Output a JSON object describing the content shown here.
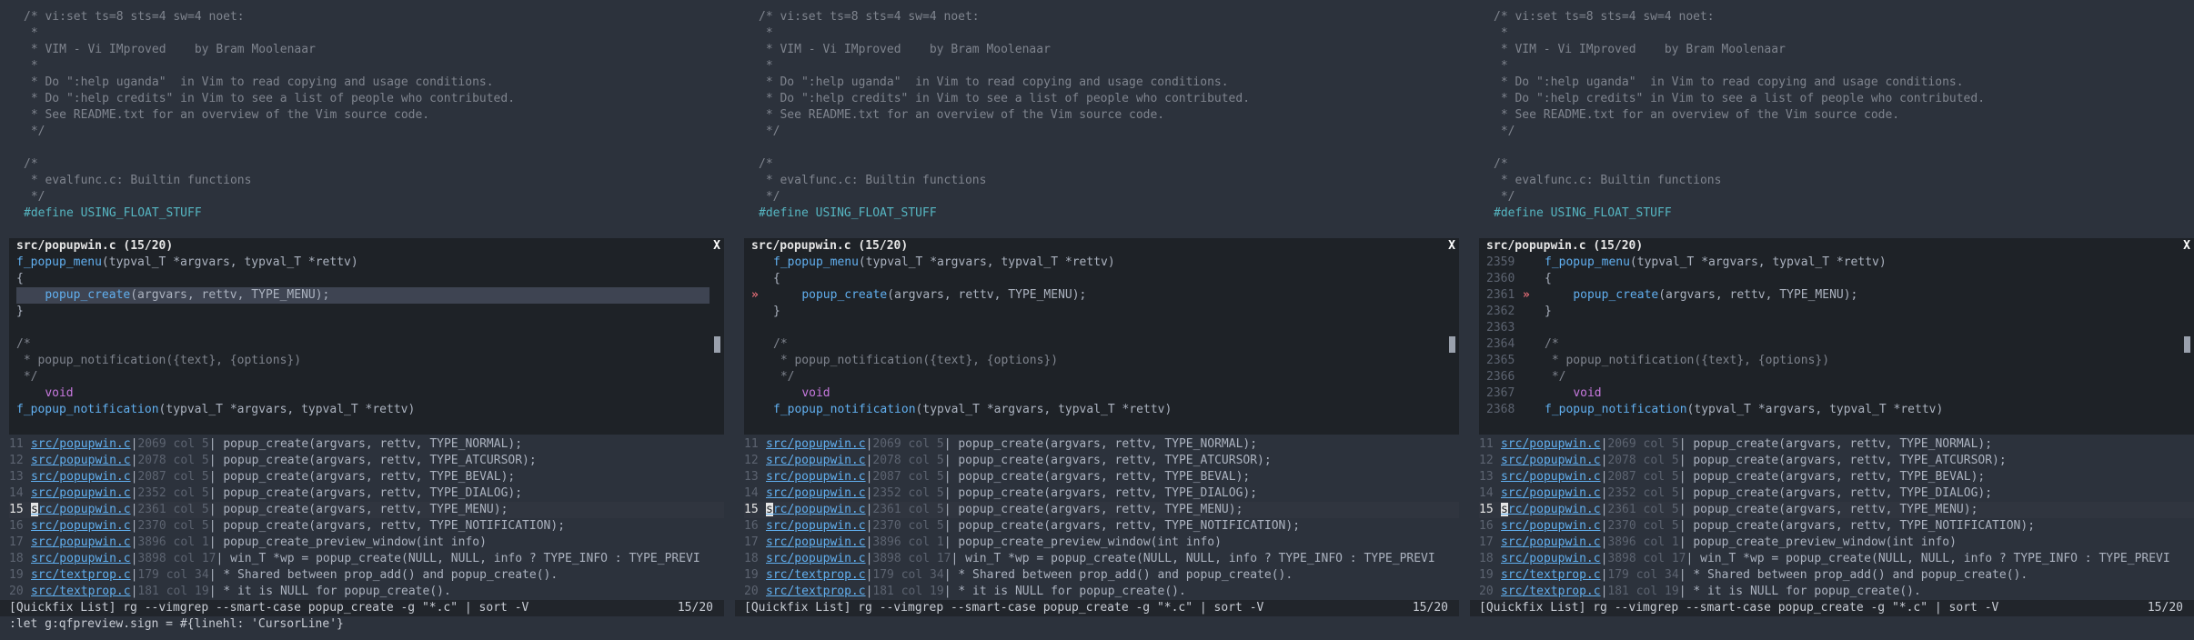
{
  "source_lines": [
    {
      "cls": "comment",
      "text": "/* vi:set ts=8 sts=4 sw=4 noet:"
    },
    {
      "cls": "comment",
      "text": " *"
    },
    {
      "cls": "comment",
      "text": " * VIM - Vi IMproved    by Bram Moolenaar"
    },
    {
      "cls": "comment",
      "text": " *"
    },
    {
      "cls": "comment",
      "text": " * Do \":help uganda\"  in Vim to read copying and usage conditions."
    },
    {
      "cls": "comment",
      "text": " * Do \":help credits\" in Vim to see a list of people who contributed."
    },
    {
      "cls": "comment",
      "text": " * See README.txt for an overview of the Vim source code."
    },
    {
      "cls": "comment",
      "text": " */"
    },
    {
      "cls": "",
      "text": ""
    },
    {
      "cls": "comment",
      "text": "/*"
    },
    {
      "cls": "comment",
      "text": " * evalfunc.c: Builtin functions"
    },
    {
      "cls": "comment",
      "text": " */"
    },
    {
      "cls": "pre",
      "text": "#define USING_FLOAT_STUFF"
    }
  ],
  "popup": {
    "title": "src/popupwin.c (15/20)",
    "close": "X",
    "sign_text": "»",
    "lines": [
      {
        "num": "2359",
        "parts": [
          {
            "c": "fn",
            "t": "f_popup_menu"
          },
          {
            "c": "",
            "t": "(typval_T *argvars, typval_T *rettv)"
          }
        ]
      },
      {
        "num": "2360",
        "parts": [
          {
            "c": "",
            "t": "{"
          }
        ]
      },
      {
        "num": "2361",
        "parts": [
          {
            "c": "",
            "t": "    "
          },
          {
            "c": "fn",
            "t": "popup_create"
          },
          {
            "c": "",
            "t": "(argvars, rettv, TYPE_MENU);"
          }
        ],
        "target": true
      },
      {
        "num": "2362",
        "parts": [
          {
            "c": "",
            "t": "}"
          }
        ]
      },
      {
        "num": "2363",
        "parts": [
          {
            "c": "",
            "t": ""
          }
        ]
      },
      {
        "num": "2364",
        "parts": [
          {
            "c": "comment",
            "t": "/*"
          }
        ]
      },
      {
        "num": "2365",
        "parts": [
          {
            "c": "comment",
            "t": " * popup_notification({text}, {options})"
          }
        ]
      },
      {
        "num": "2366",
        "parts": [
          {
            "c": "comment",
            "t": " */"
          }
        ]
      },
      {
        "num": "2367",
        "parts": [
          {
            "c": "",
            "t": "    "
          },
          {
            "c": "kw",
            "t": "void"
          }
        ]
      },
      {
        "num": "2368",
        "parts": [
          {
            "c": "fn",
            "t": "f_popup_notification"
          },
          {
            "c": "",
            "t": "(typval_T *argvars, typval_T *rettv)"
          }
        ]
      }
    ]
  },
  "quickfix": [
    {
      "idx": "11",
      "file": "src/popupwin.c",
      "pos": "2069 col 5",
      "text": " popup_create(argvars, rettv, TYPE_NORMAL);"
    },
    {
      "idx": "12",
      "file": "src/popupwin.c",
      "pos": "2078 col 5",
      "text": " popup_create(argvars, rettv, TYPE_ATCURSOR);"
    },
    {
      "idx": "13",
      "file": "src/popupwin.c",
      "pos": "2087 col 5",
      "text": " popup_create(argvars, rettv, TYPE_BEVAL);"
    },
    {
      "idx": "14",
      "file": "src/popupwin.c",
      "pos": "2352 col 5",
      "text": " popup_create(argvars, rettv, TYPE_DIALOG);"
    },
    {
      "idx": "15",
      "file": "src/popupwin.c",
      "pos": "2361 col 5",
      "text": " popup_create(argvars, rettv, TYPE_MENU);",
      "current": true
    },
    {
      "idx": "16",
      "file": "src/popupwin.c",
      "pos": "2370 col 5",
      "text": " popup_create(argvars, rettv, TYPE_NOTIFICATION);"
    },
    {
      "idx": "17",
      "file": "src/popupwin.c",
      "pos": "3896 col 1",
      "text": " popup_create_preview_window(int info)"
    },
    {
      "idx": "18",
      "file": "src/popupwin.c",
      "pos": "3898 col 17",
      "text": " win_T *wp = popup_create(NULL, NULL, info ? TYPE_INFO : TYPE_PREVI"
    },
    {
      "idx": "19",
      "file": "src/textprop.c",
      "pos": "179 col 34",
      "text": " * Shared between prop_add() and popup_create()."
    },
    {
      "idx": "20",
      "file": "src/textprop.c",
      "pos": "181 col 19",
      "text": " * it is NULL for popup_create()."
    }
  ],
  "statusline": {
    "left": "[Quickfix List] rg --vimgrep --smart-case popup_create -g \"*.c\" | sort -V",
    "right": "15/20"
  },
  "cmdline": ":let g:qfpreview.sign = #{linehl: 'CursorLine'}",
  "panes": [
    {
      "mode": "cursorline"
    },
    {
      "mode": "sign"
    },
    {
      "mode": "sign-number"
    }
  ]
}
